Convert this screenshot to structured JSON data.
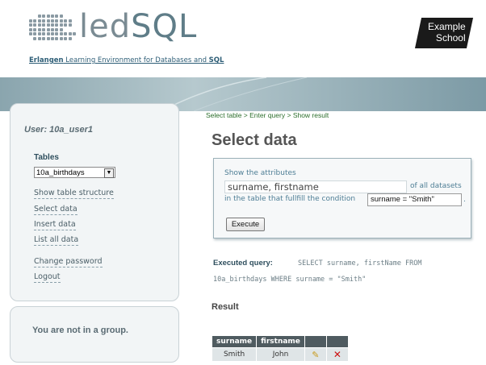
{
  "header": {
    "logo_text_led": "led",
    "logo_text_sql": "SQL",
    "tagline_part1": "Erlangen",
    "tagline_part2": " Learning Environment for Databases and ",
    "tagline_part3": "SQL",
    "school_line1": "Example",
    "school_line2": "School"
  },
  "sidebar": {
    "user": "User: 10a_user1",
    "tables_label": "Tables",
    "table_select": "10a_birthdays",
    "links": {
      "show_structure": "Show table structure",
      "select_data": "Select data",
      "insert_data": "Insert data",
      "list_all_data": "List all data",
      "change_password": "Change password",
      "logout": "Logout"
    },
    "group_status": "You are not in a group."
  },
  "main": {
    "breadcrumb": {
      "step1": "Select table",
      "step2": "Enter query",
      "step3": "Show result",
      "separator": ">"
    },
    "title": "Select data",
    "query": {
      "show_attributes_label": "Show the attributes",
      "attributes_value": "surname, firstname",
      "of_all_datasets": "of all datasets",
      "condition_label": "in the table that fullfill the condition",
      "condition_value": "surname = \"Smith\"",
      "condition_end": ".",
      "execute_label": "Execute"
    },
    "executed": {
      "label": "Executed query:",
      "line1": "SELECT surname, firstName FROM",
      "line2": "10a_birthdays WHERE surname = \"Smith\""
    },
    "result": {
      "heading": "Result",
      "columns": [
        "surname",
        "firstname"
      ],
      "rows": [
        {
          "surname": "Smith",
          "firstname": "John"
        }
      ]
    }
  },
  "colors": {
    "accent": "#5f7d88",
    "breadcrumb": "#2c6f2c",
    "delete": "#cc1111",
    "table_header": "#4f5b60"
  },
  "icons": {
    "edit": "pencil-icon",
    "delete": "delete-x-icon",
    "dropdown": "chevron-down-icon"
  }
}
